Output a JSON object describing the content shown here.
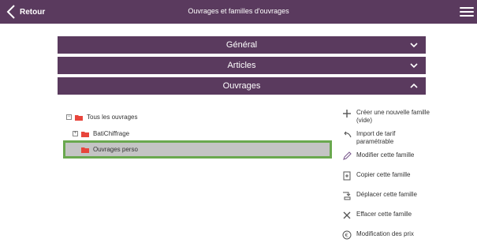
{
  "header": {
    "back_label": "Retour",
    "title": "Ouvrages et familles d'ouvrages"
  },
  "sections": [
    {
      "label": "Général",
      "state": "collapsed"
    },
    {
      "label": "Articles",
      "state": "collapsed"
    },
    {
      "label": "Ouvrages",
      "state": "expanded"
    }
  ],
  "tree": {
    "root": {
      "label": "Tous les ouvrages",
      "expander": "−"
    },
    "child1": {
      "label": "BatiChiffrage",
      "expander": "+"
    },
    "selected": {
      "label": "Ouvrages perso"
    }
  },
  "actions": [
    {
      "label": "Créer une nouvelle famille (vide)",
      "icon": "plus-icon"
    },
    {
      "label": "Import de tarif paramétrable",
      "icon": "import-icon"
    },
    {
      "label": "Modifier cette famille",
      "icon": "pencil-icon"
    },
    {
      "label": "Copier cette famille",
      "icon": "copy-icon"
    },
    {
      "label": "Déplacer cette famille",
      "icon": "move-icon"
    },
    {
      "label": "Effacer cette famille",
      "icon": "delete-icon"
    },
    {
      "label": "Modification des prix",
      "icon": "price-icon"
    }
  ],
  "colors": {
    "header_bg": "#5a3a5e",
    "selection_bg": "#c4c4c4",
    "selection_border": "#6aa84f",
    "folder": "#e8453c"
  }
}
